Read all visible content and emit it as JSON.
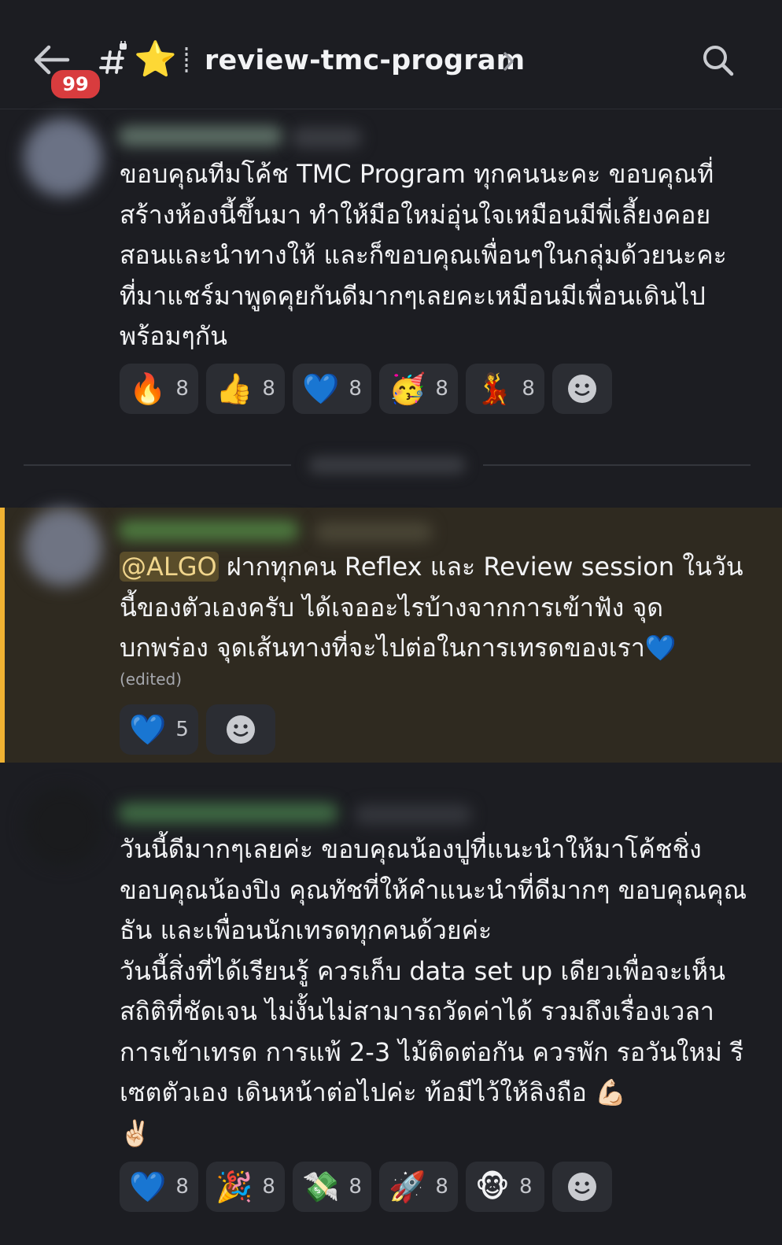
{
  "header": {
    "unread_badge": "99",
    "channel_emoji": "⭐",
    "channel_name": "review-tmc-program"
  },
  "messages": [
    {
      "text": "ขอบคุณทีมโค้ช TMC Program  ทุกคนนะคะ ขอบคุณที่สร้างห้องนี้ขึ้นมา ทำให้มือใหม่อุ่นใจเหมือนมีพี่เลี้ยงคอยสอนและนำทางให้ และก็ขอบคุณเพื่อนๆในกลุ่มด้วยนะคะที่มาแชร์มาพูดคุยกันดีมากๆเลยคะเหมือนมีเพื่อนเดินไปพร้อมๆกัน",
      "reactions": [
        {
          "emoji": "🔥",
          "count": "8"
        },
        {
          "emoji": "👍",
          "count": "8"
        },
        {
          "emoji": "💙",
          "count": "8"
        },
        {
          "emoji": "🥳",
          "count": "8"
        },
        {
          "emoji": "💃",
          "count": "8"
        }
      ]
    },
    {
      "mention": "@ALGO",
      "text": " ฝากทุกคน Reflex และ Review  session  ในวันนี้ของตัวเองครับ ได้เจออะไรบ้างจากการเข้าฟัง จุดบกพร่อง จุดเส้นทางที่จะไปต่อในการเทรดของเรา💙",
      "edited": "(edited)",
      "reactions": [
        {
          "emoji": "💙",
          "count": "5"
        }
      ]
    },
    {
      "text": "วันนี้ดีมากๆเลยค่ะ ขอบคุณน้องปูที่แนะนำให้มาโค้ชชิ่ง ขอบคุณน้องปิง คุณทัชที่ให้คำแนะนำที่ดีมากๆ ขอบคุณคุณธัน และเพื่อนนักเทรดทุกคนด้วยค่ะ\nวันนี้สิ่งที่ได้เรียนรู้ ควรเก็บ data set up เดียวเพื่อจะเห็นสถิติที่ชัดเจน ไม่งั้นไม่สามารถวัดค่าได้ รวมถึงเรื่องเวลาการเข้าเทรด  การแพ้ 2-3 ไม้ติดต่อกัน ควรพัก รอวันใหม่ รีเซตตัวเอง เดินหน้าต่อไปค่ะ ท้อมีไว้ให้ลิงถือ 💪🏻\n✌🏻",
      "reactions": [
        {
          "emoji": "💙",
          "count": "8"
        },
        {
          "emoji": "🎉",
          "count": "8"
        },
        {
          "emoji": "💸",
          "count": "8"
        },
        {
          "emoji": "🚀",
          "count": "8"
        },
        {
          "emoji": "🐵",
          "count": "8"
        }
      ]
    }
  ]
}
